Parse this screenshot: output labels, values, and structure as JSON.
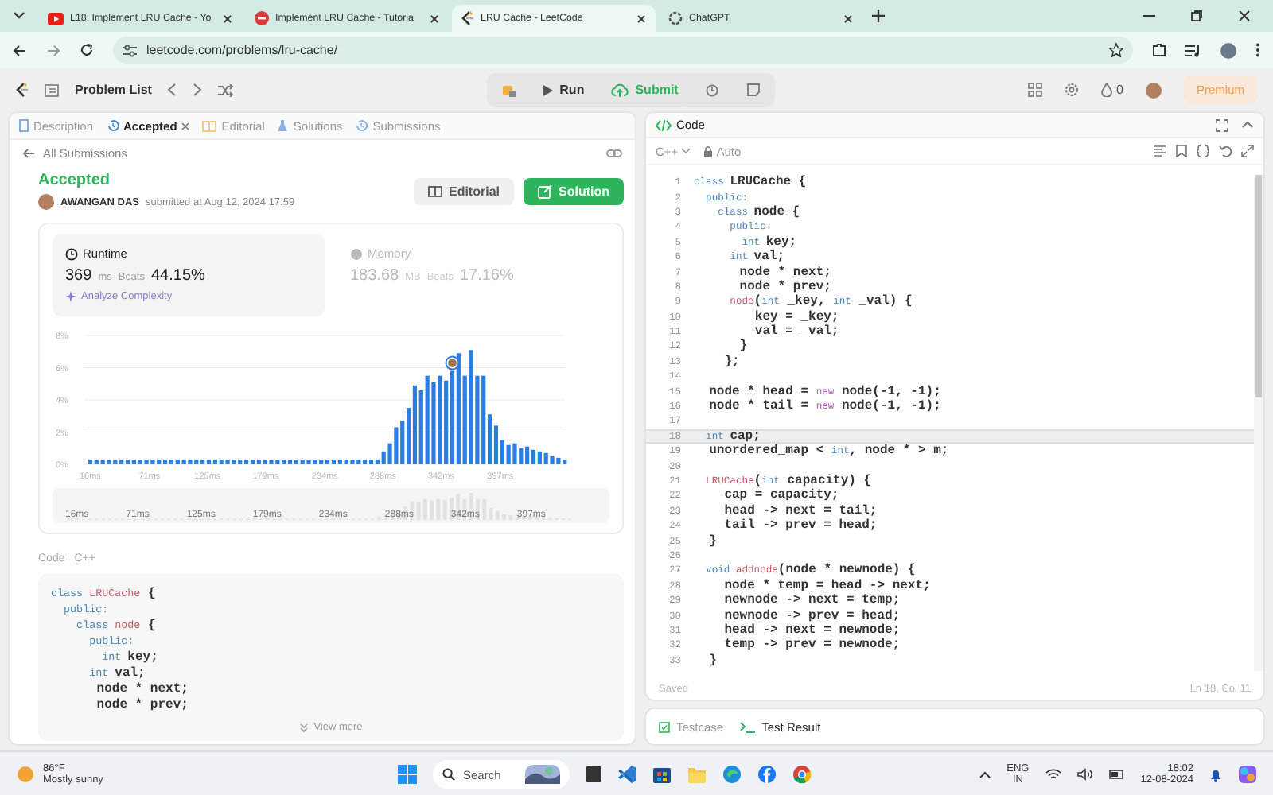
{
  "browser": {
    "tabs": [
      {
        "title": "L18. Implement LRU Cache - Yo",
        "kind": "video",
        "selected": false
      },
      {
        "title": "Implement LRU Cache - Tutoria",
        "kind": "site",
        "selected": false
      },
      {
        "title": "LRU Cache - LeetCode",
        "kind": "leetcode",
        "selected": true
      },
      {
        "title": "ChatGPT",
        "kind": "chat",
        "selected": false
      }
    ],
    "address": "leetcode.com/problems/lru-cache/"
  },
  "toolbar": {
    "problem_list": "Problem List",
    "run": "Run",
    "submit": "Submit",
    "streak": "0",
    "premium": "Premium"
  },
  "left_panel": {
    "tabs": [
      {
        "label": "Description",
        "selected": false,
        "closable": false
      },
      {
        "label": "Accepted",
        "selected": true,
        "closable": true
      },
      {
        "label": "Editorial",
        "selected": false,
        "closable": false
      },
      {
        "label": "Solutions",
        "selected": false,
        "closable": false
      },
      {
        "label": "Submissions",
        "selected": false,
        "closable": false
      }
    ],
    "back_link": "All Submissions",
    "submission": {
      "status": "Accepted",
      "author": "AWANGAN DAS",
      "submitted": "submitted at Aug 12, 2024 17:59",
      "editorial_button": "Editorial",
      "solution_button": "Solution"
    },
    "stats": [
      {
        "label": "Runtime",
        "value": "369",
        "unit": "ms",
        "beats_label": "Beats",
        "beats": "44.15%",
        "selected": true
      },
      {
        "label": "Memory",
        "value": "183.68",
        "unit": "MB",
        "beats_label": "Beats",
        "beats": "17.16%",
        "selected": false
      }
    ],
    "analyze": "Analyze Complexity",
    "chart_data": {
      "type": "bar",
      "ylim": [
        0,
        8
      ],
      "yticks": [
        {
          "value": 0,
          "label": "0%"
        },
        {
          "value": 2,
          "label": "2%"
        },
        {
          "value": 4,
          "label": "4%"
        },
        {
          "value": 6,
          "label": "6%"
        },
        {
          "value": 8,
          "label": "8%"
        }
      ],
      "grid": true,
      "xlim": [
        10.5,
        457
      ],
      "x": [
        16,
        21.8,
        27.6,
        33.4,
        39.2,
        45,
        50.8,
        56.6,
        62.4,
        68.2,
        74,
        79.8,
        85.6,
        91.4,
        97.2,
        103,
        108.8,
        114.6,
        120.4,
        126.2,
        132,
        137.8,
        143.6,
        149.4,
        155.2,
        161,
        166.8,
        172.6,
        178.4,
        184.2,
        190,
        195.8,
        201.6,
        207.4,
        213.2,
        219,
        224.8,
        230.6,
        236.4,
        242.2,
        248,
        253.8,
        259.6,
        265.4,
        271.2,
        277,
        282.8,
        288.6,
        294.4,
        300.2,
        306,
        311.8,
        317.6,
        323.4,
        329.2,
        335,
        340.8,
        346.6,
        352.4,
        358.2,
        364,
        369.8,
        375.6,
        381.4,
        387.2,
        393,
        398.8,
        404.6,
        410.4,
        416.2,
        422,
        427.8,
        433.6,
        439.4,
        445.2,
        451,
        456.8
      ],
      "xticks": [
        {
          "value": 16,
          "label": "16ms"
        },
        {
          "value": 71,
          "label": "71ms"
        },
        {
          "value": 125,
          "label": "125ms"
        },
        {
          "value": 179,
          "label": "179ms"
        },
        {
          "value": 234,
          "label": "234ms"
        },
        {
          "value": 288,
          "label": "288ms"
        },
        {
          "value": 342,
          "label": "342ms"
        },
        {
          "value": 397,
          "label": "397ms"
        }
      ],
      "series": [
        {
          "color": "#2a7de1",
          "values": [
            0.3,
            0.3,
            0.3,
            0.3,
            0.3,
            0.3,
            0.3,
            0.3,
            0.3,
            0.3,
            0.3,
            0.3,
            0.3,
            0.3,
            0.3,
            0.3,
            0.3,
            0.3,
            0.3,
            0.3,
            0.3,
            0.3,
            0.3,
            0.3,
            0.3,
            0.3,
            0.3,
            0.3,
            0.3,
            0.3,
            0.3,
            0.3,
            0.3,
            0.3,
            0.3,
            0.3,
            0.3,
            0.3,
            0.3,
            0.3,
            0.3,
            0.3,
            0.3,
            0.3,
            0.3,
            0.3,
            0.3,
            0.8,
            1.3,
            2.3,
            2.7,
            3.5,
            4.9,
            4.6,
            5.5,
            5.1,
            5.5,
            5.2,
            5.8,
            6.9,
            5.5,
            7.1,
            5.5,
            5.5,
            3.1,
            2.4,
            1.5,
            1.2,
            1.3,
            1.0,
            1.1,
            0.9,
            0.8,
            0.7,
            0.5,
            0.4,
            0.3
          ]
        }
      ]
    },
    "overview_labels": [
      "16ms",
      "71ms",
      "125ms",
      "179ms",
      "234ms",
      "288ms",
      "342ms",
      "397ms"
    ],
    "code": {
      "label": "Code",
      "language": "C++",
      "view_more": "View more",
      "lines": [
        {
          "tokens": [
            {
              "text": "class ",
              "kind": "keyword"
            },
            {
              "text": "LRUCache",
              "kind": "name"
            },
            {
              "text": " {",
              "kind": "plain"
            }
          ]
        },
        {
          "tokens": [
            {
              "text": "  public:",
              "kind": "keyword"
            }
          ]
        },
        {
          "tokens": [
            {
              "text": "    class ",
              "kind": "keyword"
            },
            {
              "text": "node",
              "kind": "name"
            },
            {
              "text": " {",
              "kind": "plain"
            }
          ]
        },
        {
          "tokens": [
            {
              "text": "      public:",
              "kind": "keyword"
            }
          ]
        },
        {
          "tokens": [
            {
              "text": "        int ",
              "kind": "keyword"
            },
            {
              "text": "key;",
              "kind": "plain"
            }
          ]
        },
        {
          "tokens": [
            {
              "text": "      int ",
              "kind": "keyword"
            },
            {
              "text": "val;",
              "kind": "plain"
            }
          ]
        },
        {
          "tokens": [
            {
              "text": "      node * next;",
              "kind": "plain"
            }
          ]
        },
        {
          "tokens": [
            {
              "text": "      node * prev;",
              "kind": "plain"
            }
          ]
        }
      ]
    }
  },
  "editor": {
    "title": "Code",
    "language": "C++",
    "mode": "Auto",
    "status": "Saved",
    "cursor": "Ln 18, Col 11",
    "lines": [
      {
        "number": "1",
        "current": false,
        "tokens": [
          {
            "text": "class ",
            "kind": "keyword"
          },
          {
            "text": "LRUCache {",
            "kind": "plain"
          }
        ]
      },
      {
        "number": "2",
        "current": false,
        "tokens": [
          {
            "text": "  public:",
            "kind": "keyword"
          }
        ]
      },
      {
        "number": "3",
        "current": false,
        "tokens": [
          {
            "text": "    class ",
            "kind": "keyword"
          },
          {
            "text": "node {",
            "kind": "plain"
          }
        ]
      },
      {
        "number": "4",
        "current": false,
        "tokens": [
          {
            "text": "      public:",
            "kind": "keyword"
          }
        ]
      },
      {
        "number": "5",
        "current": false,
        "tokens": [
          {
            "text": "        int ",
            "kind": "keyword"
          },
          {
            "text": "key;",
            "kind": "plain"
          }
        ]
      },
      {
        "number": "6",
        "current": false,
        "tokens": [
          {
            "text": "      int ",
            "kind": "keyword"
          },
          {
            "text": "val;",
            "kind": "plain"
          }
        ]
      },
      {
        "number": "7",
        "current": false,
        "tokens": [
          {
            "text": "      node * next;",
            "kind": "plain"
          }
        ]
      },
      {
        "number": "8",
        "current": false,
        "tokens": [
          {
            "text": "      node * prev;",
            "kind": "plain"
          }
        ]
      },
      {
        "number": "9",
        "current": false,
        "tokens": [
          {
            "text": "      node",
            "kind": "name"
          },
          {
            "text": "(",
            "kind": "plain"
          },
          {
            "text": "int",
            "kind": "keyword"
          },
          {
            "text": " _key, ",
            "kind": "plain"
          },
          {
            "text": "int",
            "kind": "keyword"
          },
          {
            "text": " _val) {",
            "kind": "plain"
          }
        ]
      },
      {
        "number": "10",
        "current": false,
        "tokens": [
          {
            "text": "        key = _key;",
            "kind": "plain"
          }
        ]
      },
      {
        "number": "11",
        "current": false,
        "tokens": [
          {
            "text": "        val = _val;",
            "kind": "plain"
          }
        ]
      },
      {
        "number": "12",
        "current": false,
        "tokens": [
          {
            "text": "      }",
            "kind": "plain"
          }
        ]
      },
      {
        "number": "13",
        "current": false,
        "tokens": [
          {
            "text": "    };",
            "kind": "plain"
          }
        ]
      },
      {
        "number": "14",
        "current": false
      },
      {
        "number": "15",
        "current": false,
        "tokens": [
          {
            "text": "  node * head = ",
            "kind": "plain"
          },
          {
            "text": "new",
            "kind": "new"
          },
          {
            "text": " node(-1, -1);",
            "kind": "plain"
          }
        ]
      },
      {
        "number": "16",
        "current": false,
        "tokens": [
          {
            "text": "  node * tail = ",
            "kind": "plain"
          },
          {
            "text": "new",
            "kind": "new"
          },
          {
            "text": " node(-1, -1);",
            "kind": "plain"
          }
        ]
      },
      {
        "number": "17",
        "current": false
      },
      {
        "number": "18",
        "current": true,
        "tokens": [
          {
            "text": "  int ",
            "kind": "keyword"
          },
          {
            "text": "cap;",
            "kind": "plain"
          }
        ]
      },
      {
        "number": "19",
        "current": false,
        "tokens": [
          {
            "text": "  unordered_map < ",
            "kind": "plain"
          },
          {
            "text": "int",
            "kind": "keyword"
          },
          {
            "text": ", node * > m;",
            "kind": "plain"
          }
        ]
      },
      {
        "number": "20",
        "current": false
      },
      {
        "number": "21",
        "current": false,
        "tokens": [
          {
            "text": "  LRUCache",
            "kind": "name"
          },
          {
            "text": "(",
            "kind": "plain"
          },
          {
            "text": "int",
            "kind": "keyword"
          },
          {
            "text": " capacity) {",
            "kind": "plain"
          }
        ]
      },
      {
        "number": "22",
        "current": false,
        "tokens": [
          {
            "text": "    cap = capacity;",
            "kind": "plain"
          }
        ]
      },
      {
        "number": "23",
        "current": false,
        "tokens": [
          {
            "text": "    head -> next = tail;",
            "kind": "plain"
          }
        ]
      },
      {
        "number": "24",
        "current": false,
        "tokens": [
          {
            "text": "    tail -> prev = head;",
            "kind": "plain"
          }
        ]
      },
      {
        "number": "25",
        "current": false,
        "tokens": [
          {
            "text": "  }",
            "kind": "plain"
          }
        ]
      },
      {
        "number": "26",
        "current": false
      },
      {
        "number": "27",
        "current": false,
        "tokens": [
          {
            "text": "  void ",
            "kind": "keyword"
          },
          {
            "text": "addnode",
            "kind": "name"
          },
          {
            "text": "(node * newnode) {",
            "kind": "plain"
          }
        ]
      },
      {
        "number": "28",
        "current": false,
        "tokens": [
          {
            "text": "    node * temp = head -> next;",
            "kind": "plain"
          }
        ]
      },
      {
        "number": "29",
        "current": false,
        "tokens": [
          {
            "text": "    newnode -> next = temp;",
            "kind": "plain"
          }
        ]
      },
      {
        "number": "30",
        "current": false,
        "tokens": [
          {
            "text": "    newnode -> prev = head;",
            "kind": "plain"
          }
        ]
      },
      {
        "number": "31",
        "current": false,
        "tokens": [
          {
            "text": "    head -> next = newnode;",
            "kind": "plain"
          }
        ]
      },
      {
        "number": "32",
        "current": false,
        "tokens": [
          {
            "text": "    temp -> prev = newnode;",
            "kind": "plain"
          }
        ]
      },
      {
        "number": "33",
        "current": false,
        "tokens": [
          {
            "text": "  }",
            "kind": "plain"
          }
        ]
      }
    ]
  },
  "bottom_tabs": [
    {
      "label": "Testcase",
      "selected": false
    },
    {
      "label": "Test Result",
      "selected": true
    }
  ],
  "taskbar": {
    "temperature": "86°F",
    "condition": "Mostly sunny",
    "search": {
      "placeholder": "Search"
    },
    "language": "ENG",
    "region": "IN",
    "time": "18:02",
    "date": "12-08-2024"
  }
}
